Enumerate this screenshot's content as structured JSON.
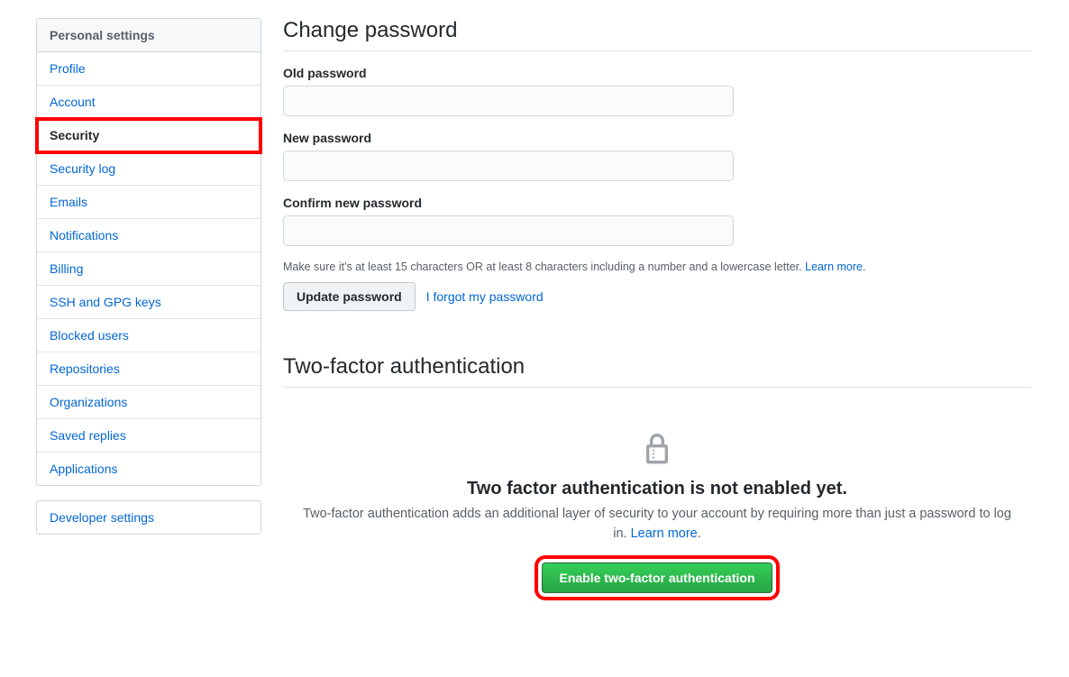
{
  "sidebar": {
    "header": "Personal settings",
    "items": [
      {
        "label": "Profile",
        "active": false
      },
      {
        "label": "Account",
        "active": false
      },
      {
        "label": "Security",
        "active": true,
        "highlighted": true
      },
      {
        "label": "Security log",
        "active": false
      },
      {
        "label": "Emails",
        "active": false
      },
      {
        "label": "Notifications",
        "active": false
      },
      {
        "label": "Billing",
        "active": false
      },
      {
        "label": "SSH and GPG keys",
        "active": false
      },
      {
        "label": "Blocked users",
        "active": false
      },
      {
        "label": "Repositories",
        "active": false
      },
      {
        "label": "Organizations",
        "active": false
      },
      {
        "label": "Saved replies",
        "active": false
      },
      {
        "label": "Applications",
        "active": false
      }
    ],
    "developer_label": "Developer settings"
  },
  "password_section": {
    "title": "Change password",
    "old_label": "Old password",
    "new_label": "New password",
    "confirm_label": "Confirm new password",
    "hint_text": "Make sure it's at least 15 characters OR at least 8 characters including a number and a lowercase letter. ",
    "hint_link": "Learn more",
    "hint_suffix": ".",
    "update_button": "Update password",
    "forgot_link": "I forgot my password"
  },
  "tfa_section": {
    "title": "Two-factor authentication",
    "status": "Two factor authentication is not enabled yet.",
    "desc_text": "Two-factor authentication adds an additional layer of security to your account by requiring more than just a password to log in. ",
    "desc_link": "Learn more",
    "desc_suffix": ".",
    "enable_button": "Enable two-factor authentication"
  }
}
